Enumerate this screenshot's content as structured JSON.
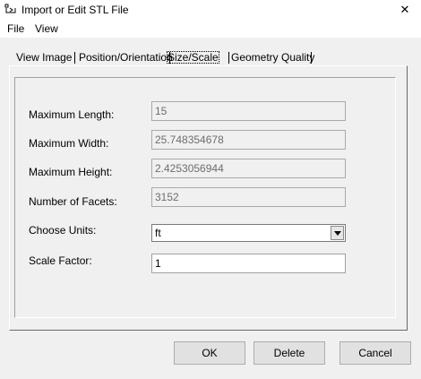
{
  "window": {
    "title": "Import or Edit STL File",
    "close_glyph": "✕"
  },
  "menu": [
    "File",
    "View"
  ],
  "tabs": [
    {
      "label": "View Image",
      "active": false
    },
    {
      "label": "Position/Orientation",
      "active": false
    },
    {
      "label": "Size/Scale",
      "active": true
    },
    {
      "label": "Geometry Quality",
      "active": false
    }
  ],
  "fields": {
    "max_length": {
      "label": "Maximum Length:",
      "value": "15"
    },
    "max_width": {
      "label": "Maximum Width:",
      "value": "25.748354678"
    },
    "max_height": {
      "label": "Maximum Height:",
      "value": "2.4253056944"
    },
    "num_facets": {
      "label": "Number of Facets:",
      "value": "3152"
    },
    "units": {
      "label": "Choose Units:",
      "value": "ft"
    },
    "scale_factor": {
      "label": "Scale Factor:",
      "value": "1"
    }
  },
  "buttons": {
    "ok": "OK",
    "delete": "Delete",
    "cancel": "Cancel"
  },
  "icons": {
    "app": "stl-file-icon",
    "dropdown": "chevron-down-icon"
  }
}
